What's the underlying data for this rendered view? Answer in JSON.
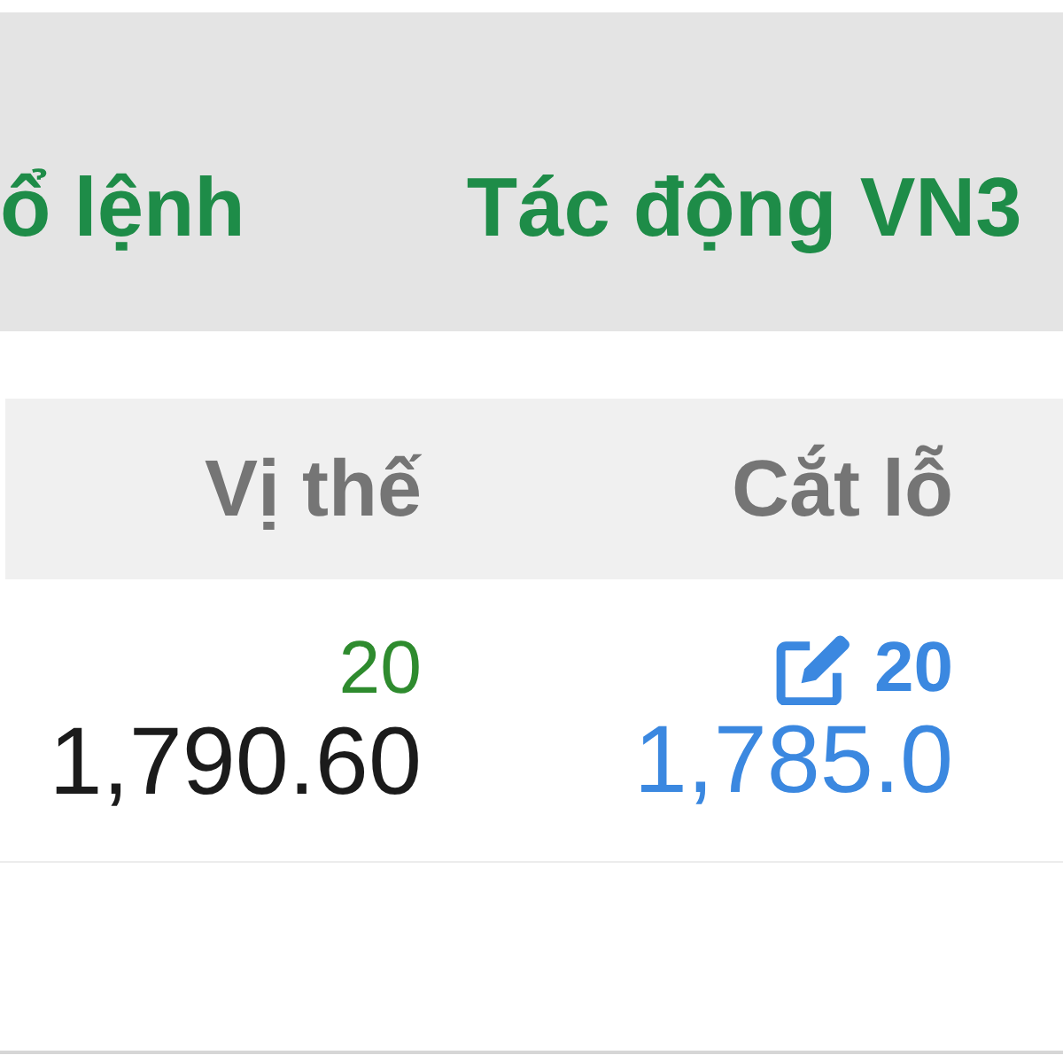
{
  "tabs": [
    {
      "label": "ổ lệnh"
    },
    {
      "label": "Tác động VN3"
    }
  ],
  "table": {
    "columns": [
      "Vị thế",
      "Cắt lỗ"
    ],
    "rows": [
      {
        "position": {
          "quantity": "20",
          "price": "1,790.60"
        },
        "stop_loss": {
          "quantity": "20",
          "price": "1,785.0"
        }
      }
    ]
  }
}
